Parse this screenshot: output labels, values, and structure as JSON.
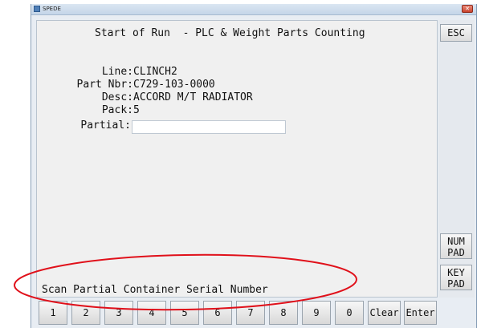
{
  "window": {
    "title": "SPEDE",
    "close_glyph": "✕"
  },
  "screen": {
    "header": "Start of Run  - PLC & Weight Parts Counting",
    "fields": [
      {
        "label": "Line:",
        "value": "CLINCH2"
      },
      {
        "label": "Part Nbr:",
        "value": "C729-103-0000"
      },
      {
        "label": "Desc:",
        "value": "ACCORD M/T RADIATOR"
      },
      {
        "label": "Pack:",
        "value": "5"
      },
      {
        "label": "Partial:",
        "value": ""
      }
    ],
    "partial_input_value": "",
    "status": "Scan Partial Container Serial Number"
  },
  "side_buttons": {
    "esc": "ESC",
    "numpad": "NUM\nPAD",
    "keypad": "KEY\nPAD"
  },
  "keys": [
    "1",
    "2",
    "3",
    "4",
    "5",
    "6",
    "7",
    "8",
    "9",
    "0",
    "Clear",
    "Enter"
  ],
  "colors": {
    "annotation": "#e0101a",
    "panel": "#f0f0f0",
    "window": "#e8edf3"
  }
}
